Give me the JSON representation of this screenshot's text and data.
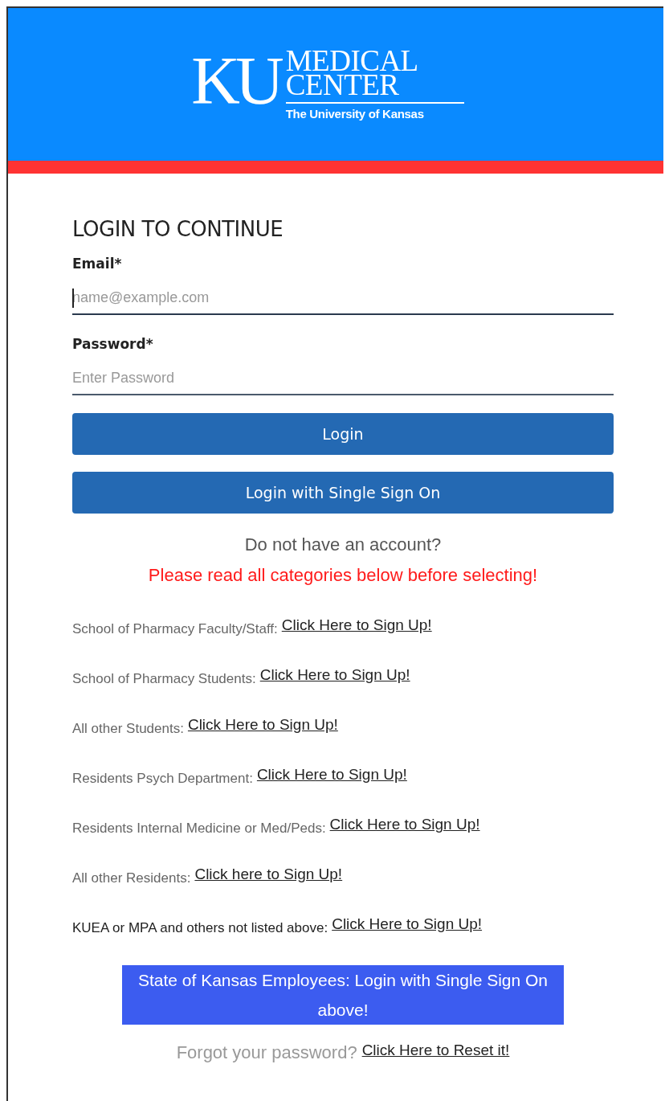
{
  "logo": {
    "mark": "KU",
    "line1": "MEDICAL",
    "line2": "CENTER",
    "tagline": "The University of Kansas"
  },
  "heading": "LOGIN TO CONTINUE",
  "fields": [
    {
      "label": "Email*",
      "placeholder": "name@example.com",
      "focused": true
    },
    {
      "label": "Password*",
      "placeholder": "Enter Password",
      "focused": false
    }
  ],
  "buttons": [
    "Login",
    "Login with Single Sign On"
  ],
  "signup_prompt": "Do not have an account?",
  "warning": "Please read all categories below before selecting!",
  "categories": [
    {
      "label": "School of Pharmacy Faculty/Staff:",
      "link": "Click Here to Sign Up!",
      "muted": true
    },
    {
      "label": "School of Pharmacy Students:",
      "link": "Click Here to Sign Up!",
      "muted": true
    },
    {
      "label": "All other Students:",
      "link": "Click Here to Sign Up!",
      "muted": true
    },
    {
      "label": "Residents Psych Department:",
      "link": "Click Here to Sign Up!",
      "muted": true
    },
    {
      "label": "Residents Internal Medicine or Med/Peds:",
      "link": "Click Here to Sign Up!",
      "muted": true
    },
    {
      "label": "All other Residents:",
      "link": "Click here to Sign Up!",
      "muted": true
    },
    {
      "label": "KUEA or MPA and others not listed above:",
      "link": "Click Here to Sign Up!",
      "muted": false
    }
  ],
  "state_notice": {
    "text": "State of Kansas Employees: Login with Single Sign On above!",
    "highlighted": true
  },
  "forgot": {
    "text": "Forgot your password?",
    "link": "Click Here to Reset it!"
  }
}
